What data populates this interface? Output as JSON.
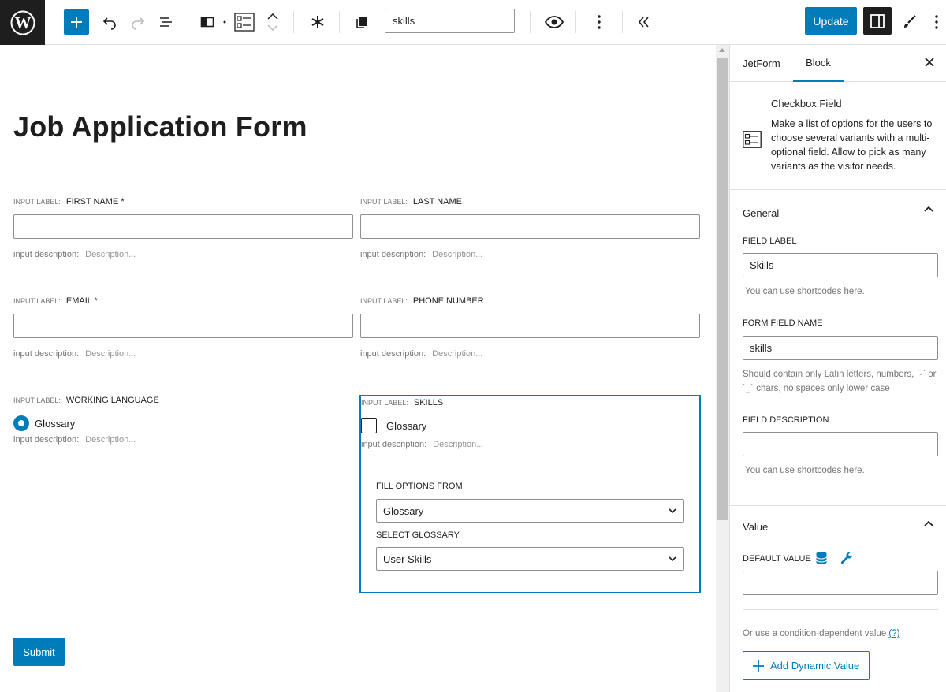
{
  "toolbar": {
    "search_value": "skills",
    "update_label": "Update"
  },
  "canvas": {
    "page_title": "Job Application Form",
    "label_key": "INPUT LABEL:",
    "desc_key": "input description:",
    "desc_placeholder": "Description...",
    "fields": {
      "first_name": "FIRST NAME *",
      "last_name": "LAST NAME",
      "email": "EMAIL *",
      "phone": "PHONE NUMBER",
      "working_language": "WORKING LANGUAGE",
      "skills": "SKILLS"
    },
    "radio_option": "Glossary",
    "checkbox_option": "Glossary",
    "fill_options_label": "FILL OPTIONS FROM",
    "fill_options_value": "Glossary",
    "select_glossary_label": "SELECT GLOSSARY",
    "select_glossary_value": "User Skills",
    "submit_label": "Submit"
  },
  "sidebar": {
    "tabs": [
      "JetForm",
      "Block"
    ],
    "active_tab": "Block",
    "block_title": "Checkbox Field",
    "block_desc": "Make a list of options for the users to choose several variants with a multi-optional field. Allow to pick as many variants as the visitor needs.",
    "general": {
      "title": "General",
      "field_label_label": "FIELD LABEL",
      "field_label_value": "Skills",
      "field_label_help": "You can use shortcodes here.",
      "form_field_name_label": "FORM FIELD NAME",
      "form_field_name_value": "skills",
      "form_field_name_help": "Should contain only Latin letters, numbers, `-` or `_` chars, no spaces only lower case",
      "field_desc_label": "FIELD DESCRIPTION",
      "field_desc_value": "",
      "field_desc_help": "You can use shortcodes here."
    },
    "value": {
      "title": "Value",
      "default_value_label": "DEFAULT VALUE",
      "default_value": "",
      "condition_text": "Or use a condition-dependent value",
      "condition_link": "(?)",
      "add_dynamic_label": "Add Dynamic Value"
    }
  },
  "colors": {
    "accent": "#007cba",
    "dark": "#1e1e1e",
    "border": "#e0e0e0"
  }
}
